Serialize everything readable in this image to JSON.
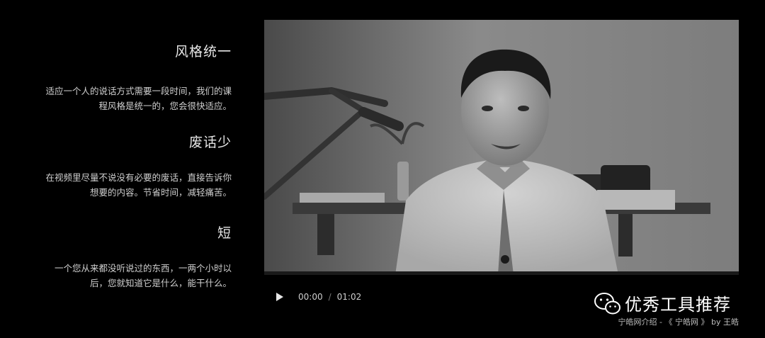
{
  "features": [
    {
      "title": "风格统一",
      "desc_lines": [
        "适应一个人的说话方式需要一段时间，我们的课",
        "程风格是统一的，您会很快适应。"
      ]
    },
    {
      "title": "废话少",
      "desc_lines": [
        "在视频里尽量不说没有必要的废话，直接告诉你",
        "想要的内容。节省时间，减轻痛苦。"
      ]
    },
    {
      "title": "短",
      "desc_lines": [
        "一个您从来都没听说过的东西，一两个小时以",
        "后，您就知道它是什么，能干什么。"
      ]
    }
  ],
  "player": {
    "current_time": "00:00",
    "separator": "/",
    "duration": "01:02",
    "play_icon": "play-icon"
  },
  "watermark": {
    "logo_icon": "wechat-icon",
    "title": "优秀工具推荐",
    "credit": "宁皓网介绍 - 《 宁皓网 》 by 王皓"
  },
  "colors": {
    "background": "#000000",
    "text": "#e6e6e6",
    "muted": "#cfcfcf"
  }
}
